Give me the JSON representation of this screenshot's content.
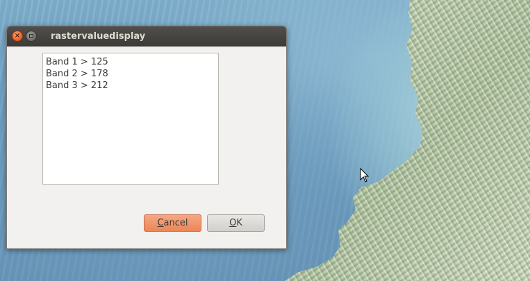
{
  "window": {
    "title": "rastervaluedisplay"
  },
  "bands": [
    {
      "label": "Band 1 > 125"
    },
    {
      "label": "Band 2 > 178"
    },
    {
      "label": "Band 3 > 212"
    }
  ],
  "buttons": {
    "cancel_mnemonic": "C",
    "cancel_rest": "ancel",
    "ok_mnemonic": "O",
    "ok_rest": "K"
  },
  "icons": {
    "close": "close-icon",
    "minimize": "minimize-icon",
    "pointer": "mouse-pointer-icon"
  },
  "colors": {
    "accent_orange": "#ec8658",
    "titlebar": "#3c3b37",
    "dialog_bg": "#f2f1ef"
  }
}
